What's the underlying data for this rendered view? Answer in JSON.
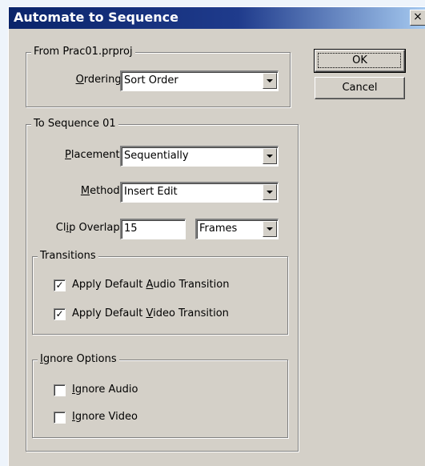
{
  "dialog": {
    "title": "Automate to Sequence",
    "close_glyph": "×"
  },
  "from_group": {
    "legend": "From Prac01.prproj",
    "ordering": {
      "label_first": "O",
      "label_rest": "rdering:",
      "value": "Sort Order"
    }
  },
  "to_group": {
    "legend": "To Sequence 01",
    "placement": {
      "label_first": "P",
      "label_rest": "lacement:",
      "value": "Sequentially"
    },
    "method": {
      "label_pre": "",
      "label_first": "M",
      "label_rest": "ethod:",
      "value": "Insert Edit"
    },
    "clip_overlap": {
      "label_pre": "Cl",
      "label_first": "i",
      "label_rest": "p Overlap:",
      "value": "15",
      "unit": "Frames"
    },
    "transitions": {
      "legend": "Transitions",
      "audio": {
        "pre": "Apply Default ",
        "first": "A",
        "rest": "udio Transition",
        "checked": true,
        "mark": "✓"
      },
      "video": {
        "pre": "Apply Default ",
        "first": "V",
        "rest": "ideo Transition",
        "checked": true,
        "mark": "✓"
      }
    },
    "ignore": {
      "legend_first": "I",
      "legend_rest": "gnore Options",
      "audio": {
        "first": "I",
        "rest": "gnore Audio",
        "checked": false
      },
      "video": {
        "first": "I",
        "rest": "gnore Video",
        "checked": false
      }
    }
  },
  "buttons": {
    "ok": "OK",
    "cancel": "Cancel"
  }
}
